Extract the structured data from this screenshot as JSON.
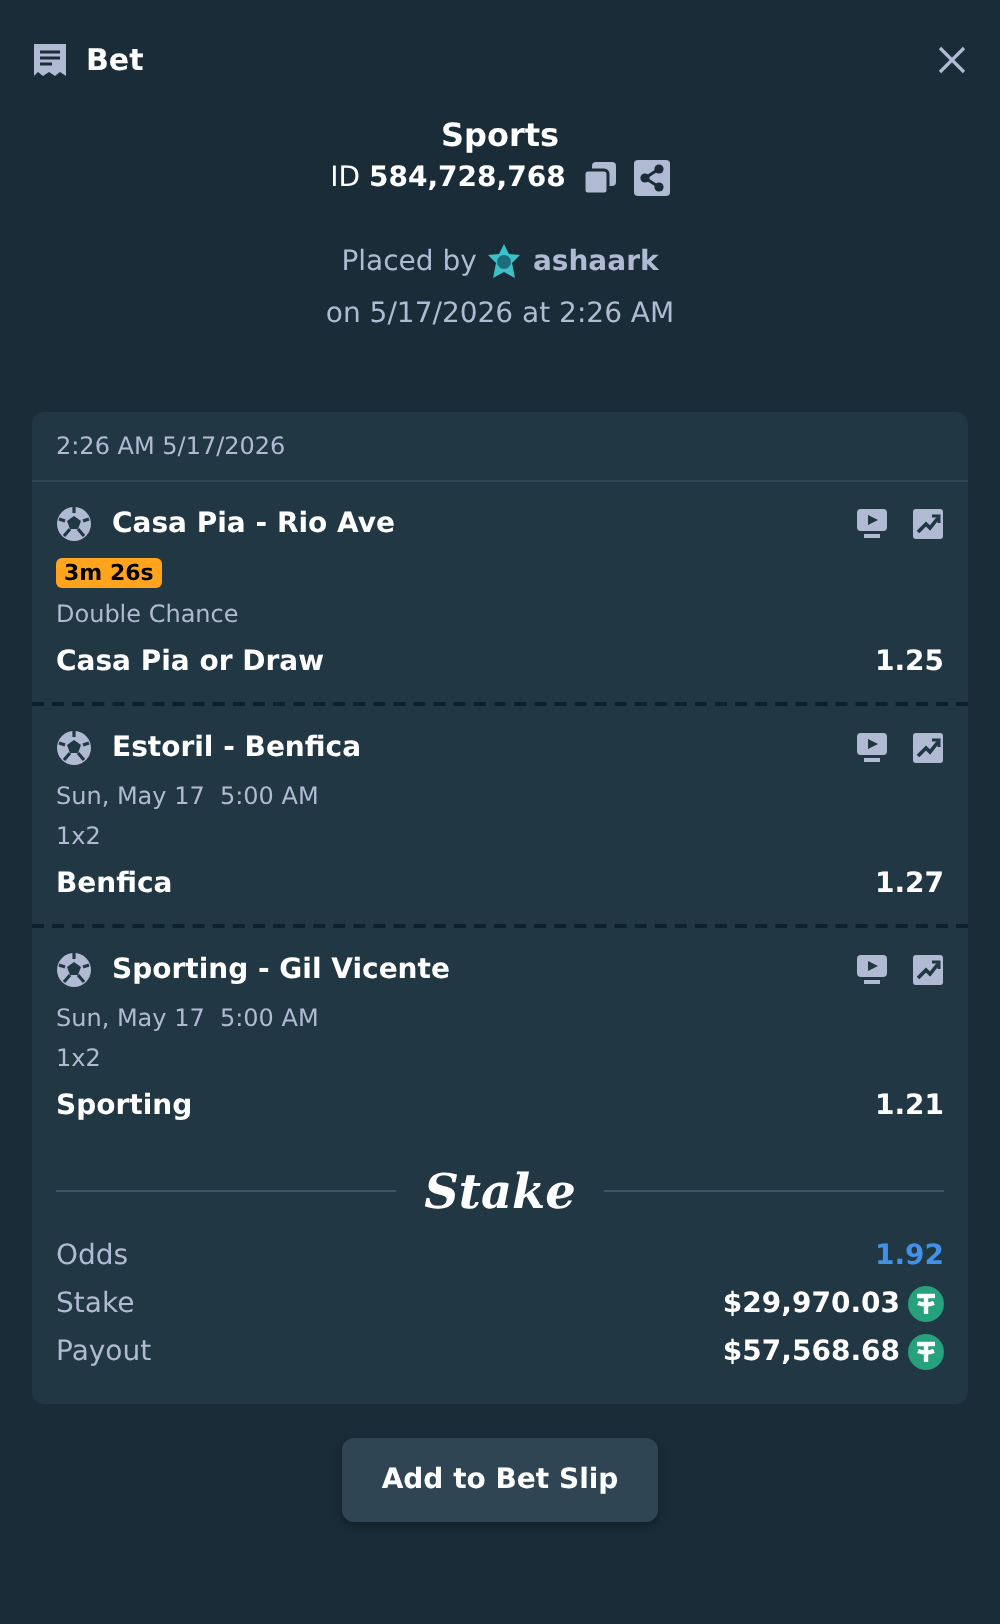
{
  "header": {
    "title": "Bet"
  },
  "bet": {
    "category": "Sports",
    "id_label": "ID",
    "id": "584,728,768",
    "placed_by": "Placed by",
    "user": "ashaark",
    "placed_on": "on 5/17/2026 at 2:26 AM"
  },
  "slip": {
    "timestamp": "2:26 AM 5/17/2026",
    "legs": [
      {
        "event": "Casa Pia - Rio Ave",
        "timer": "3m 26s",
        "market": "Double Chance",
        "outcome": "Casa Pia or Draw",
        "odds": "1.25"
      },
      {
        "event": "Estoril - Benfica",
        "start": "Sun, May 17  5:00 AM",
        "market": "1x2",
        "outcome": "Benfica",
        "odds": "1.27"
      },
      {
        "event": "Sporting - Gil Vicente",
        "start": "Sun, May 17  5:00 AM",
        "market": "1x2",
        "outcome": "Sporting",
        "odds": "1.21"
      }
    ],
    "brand": "Stake",
    "summary": [
      {
        "kind": "odds",
        "label": "Odds",
        "value": "1.92"
      },
      {
        "kind": "amount",
        "label": "Stake",
        "value": "$29,970.03"
      },
      {
        "kind": "amount",
        "label": "Payout",
        "value": "$57,568.68"
      }
    ]
  },
  "action": "Add to Bet Slip"
}
